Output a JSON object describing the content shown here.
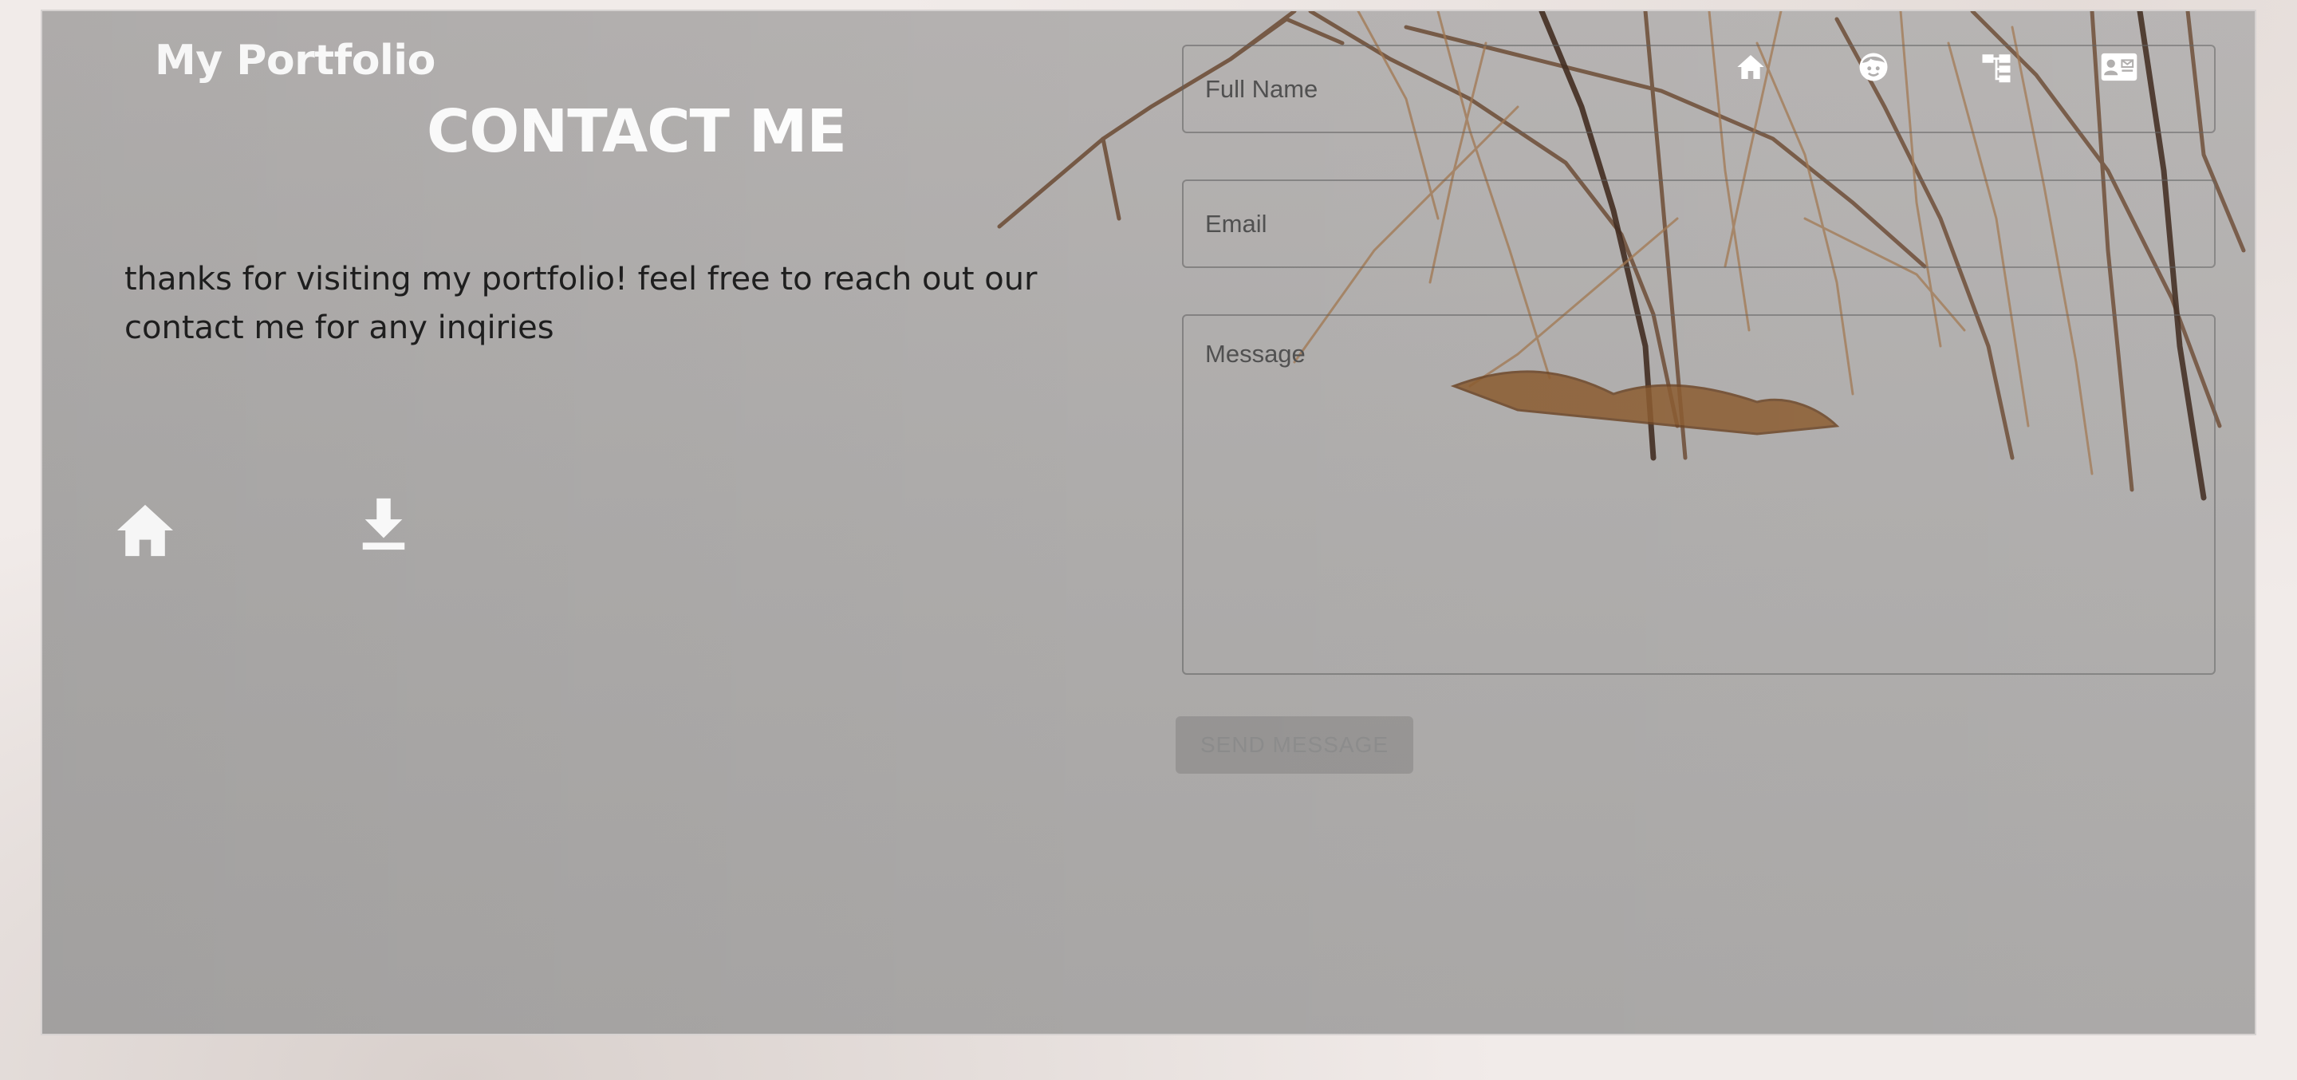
{
  "header": {
    "brand": "My Portfolio",
    "nav": [
      {
        "icon": "home-icon"
      },
      {
        "icon": "face-icon"
      },
      {
        "icon": "sitemap-icon"
      },
      {
        "icon": "contact-card-icon"
      }
    ]
  },
  "contact": {
    "title": "CONTACT ME",
    "intro": "thanks for visiting my portfolio! feel free to reach out our contact me for any inqiries",
    "icons": [
      "home-icon",
      "download-icon"
    ]
  },
  "form": {
    "name_placeholder": "Full Name",
    "name_value": "",
    "email_placeholder": "Email",
    "email_value": "",
    "message_placeholder": "Message",
    "message_value": "",
    "send_label": "SEND MESSAGE"
  },
  "colors": {
    "panel": "#aeacab",
    "text_light": "#ffffff",
    "text_dark": "#1f1f1f",
    "button_text": "#8b8b8b"
  }
}
